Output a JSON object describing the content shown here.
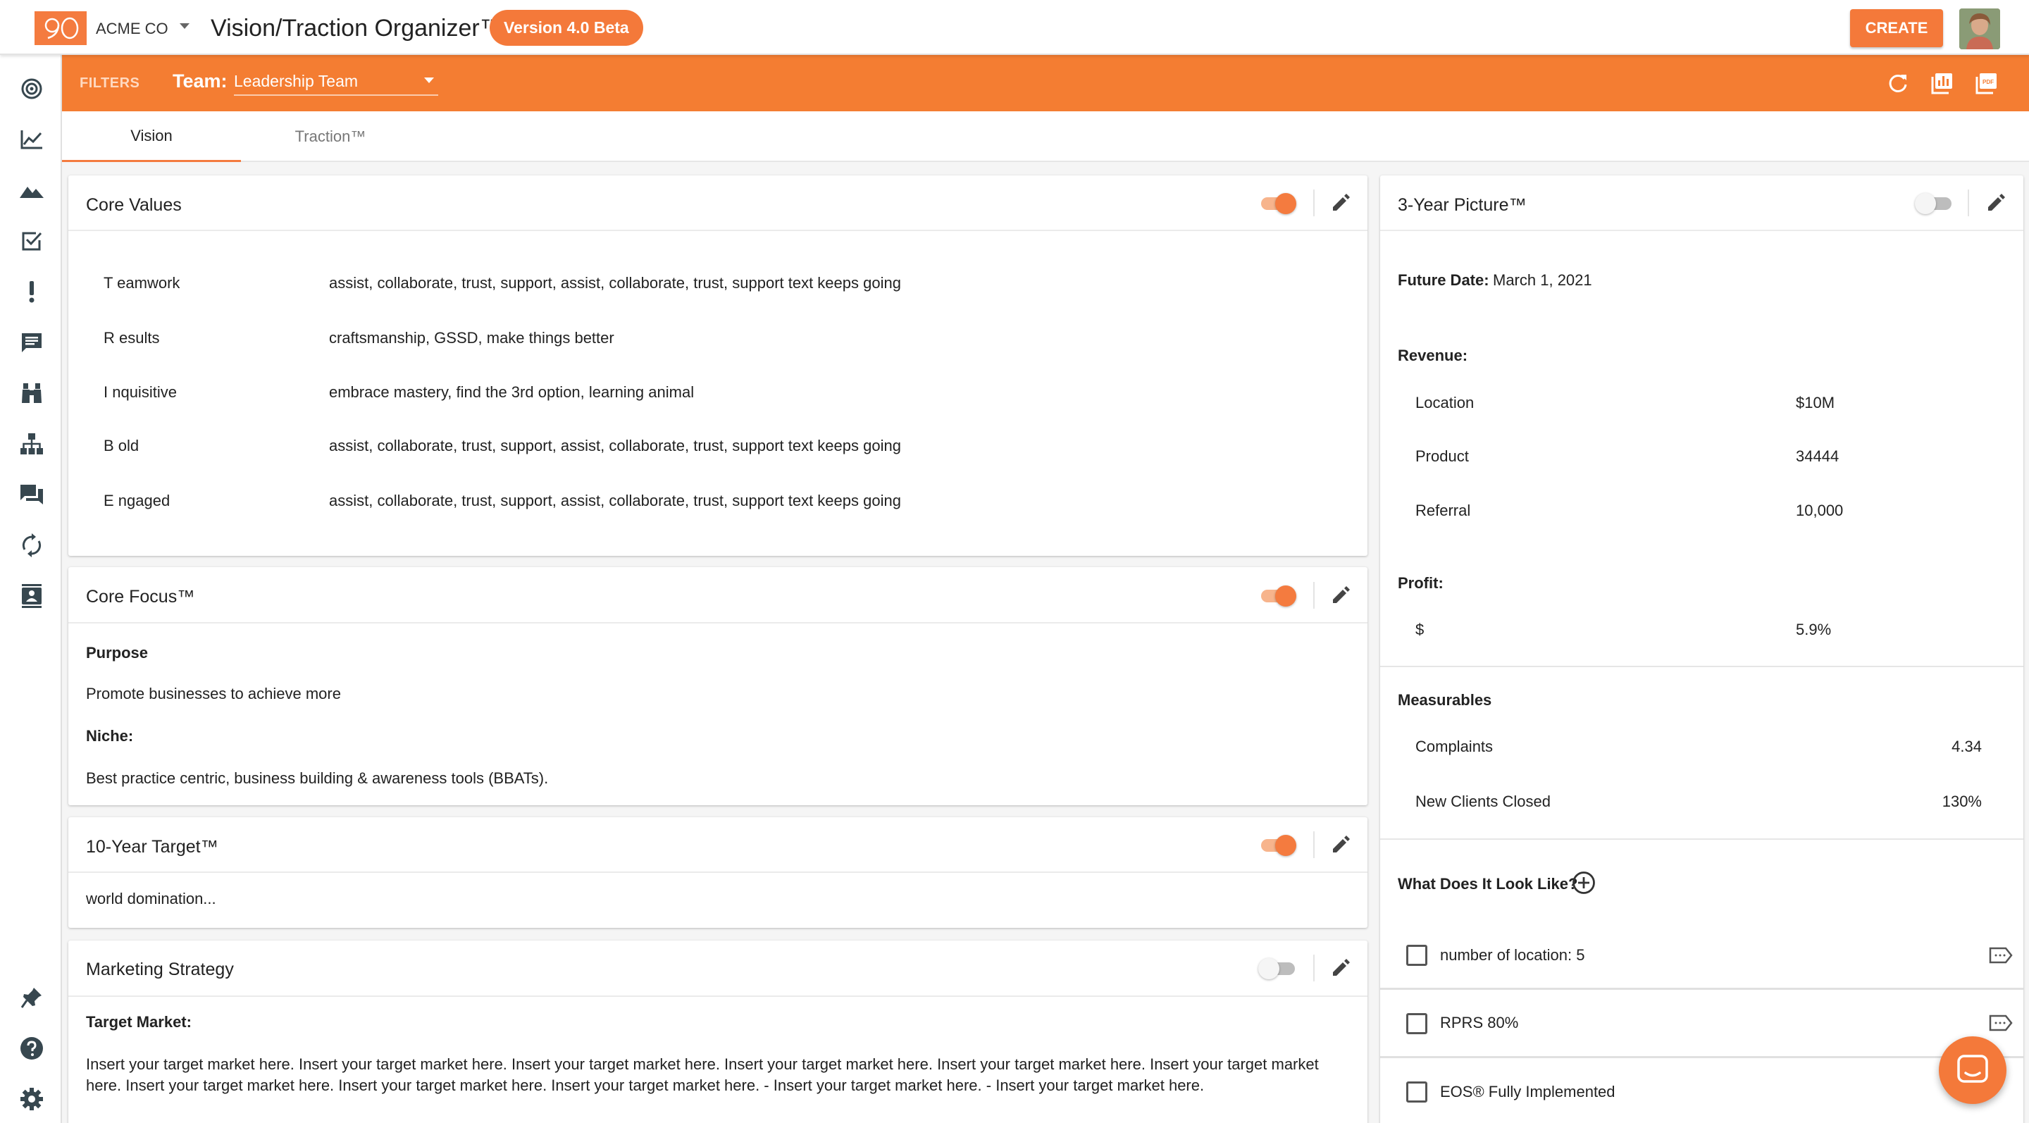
{
  "app": {
    "company": "ACME CO",
    "title": "Vision/Traction Organizer™",
    "version_badge": "Version 4.0 Beta",
    "create_label": "CREATE"
  },
  "rail": {
    "icons": [
      "target-icon",
      "chart-line-icon",
      "mountain-icon",
      "checkbox-icon",
      "exclamation-icon",
      "message-list-icon",
      "binoculars-icon",
      "org-chart-icon",
      "chat-icon",
      "sync-icon",
      "contact-card-icon",
      "pin-icon",
      "help-icon",
      "settings-icon"
    ]
  },
  "filters": {
    "label": "FILTERS",
    "team_label": "Team:",
    "team_value": "Leadership Team"
  },
  "tabs": [
    {
      "label": "Vision",
      "active": true
    },
    {
      "label": "Traction™",
      "active": false
    }
  ],
  "core_values": {
    "title": "Core Values",
    "enabled": true,
    "items": [
      {
        "name": "T eamwork",
        "desc": "assist, collaborate, trust, support, assist, collaborate, trust, support text keeps going"
      },
      {
        "name": "R esults",
        "desc": "craftsmanship, GSSD, make things better"
      },
      {
        "name": "I nquisitive",
        "desc": "embrace mastery, find the 3rd option, learning animal"
      },
      {
        "name": "B old",
        "desc": "assist, collaborate, trust, support, assist, collaborate, trust, support text keeps going"
      },
      {
        "name": "E ngaged",
        "desc": "assist, collaborate, trust, support, assist, collaborate, trust, support text keeps going"
      }
    ]
  },
  "core_focus": {
    "title": "Core Focus™",
    "enabled": true,
    "purpose_label": "Purpose",
    "purpose": "Promote businesses to achieve more",
    "niche_label": "Niche:",
    "niche": "Best practice centric, business building & awareness tools (BBATs)."
  },
  "ten_year": {
    "title": "10-Year Target™",
    "enabled": true,
    "text": "world domination..."
  },
  "marketing": {
    "title": "Marketing Strategy",
    "enabled": false,
    "target_label": "Target Market:",
    "target_line1": "Insert your target market here. Insert your target market here. Insert your target market here. Insert your target market here. Insert your target market here. Insert your target market",
    "target_line2": "here. Insert your target market here. Insert your target market here. Insert your target market here. - Insert your target market here. - Insert your target market here."
  },
  "three_year": {
    "title": "3-Year Picture™",
    "enabled": false,
    "future_date_label": "Future Date:",
    "future_date": "March 1, 2021",
    "revenue_label": "Revenue:",
    "revenue": [
      {
        "name": "Location",
        "value": "$10M"
      },
      {
        "name": "Product",
        "value": "34444"
      },
      {
        "name": "Referral",
        "value": "10,000"
      }
    ],
    "profit_label": "Profit:",
    "profit": {
      "name": "$",
      "value": "5.9%"
    },
    "measurables_label": "Measurables",
    "measurables": [
      {
        "name": "Complaints",
        "value": "4.34"
      },
      {
        "name": "New Clients Closed",
        "value": "130%"
      }
    ],
    "look_like_label": "What Does It Look Like?",
    "look_like": [
      {
        "text": "number of location: 5",
        "checked": false
      },
      {
        "text": "RPRS 80%",
        "checked": false
      },
      {
        "text": "EOS® Fully Implemented",
        "checked": false
      }
    ]
  },
  "colors": {
    "brand": "#f47b3f",
    "filter_bar": "#f47d32"
  }
}
